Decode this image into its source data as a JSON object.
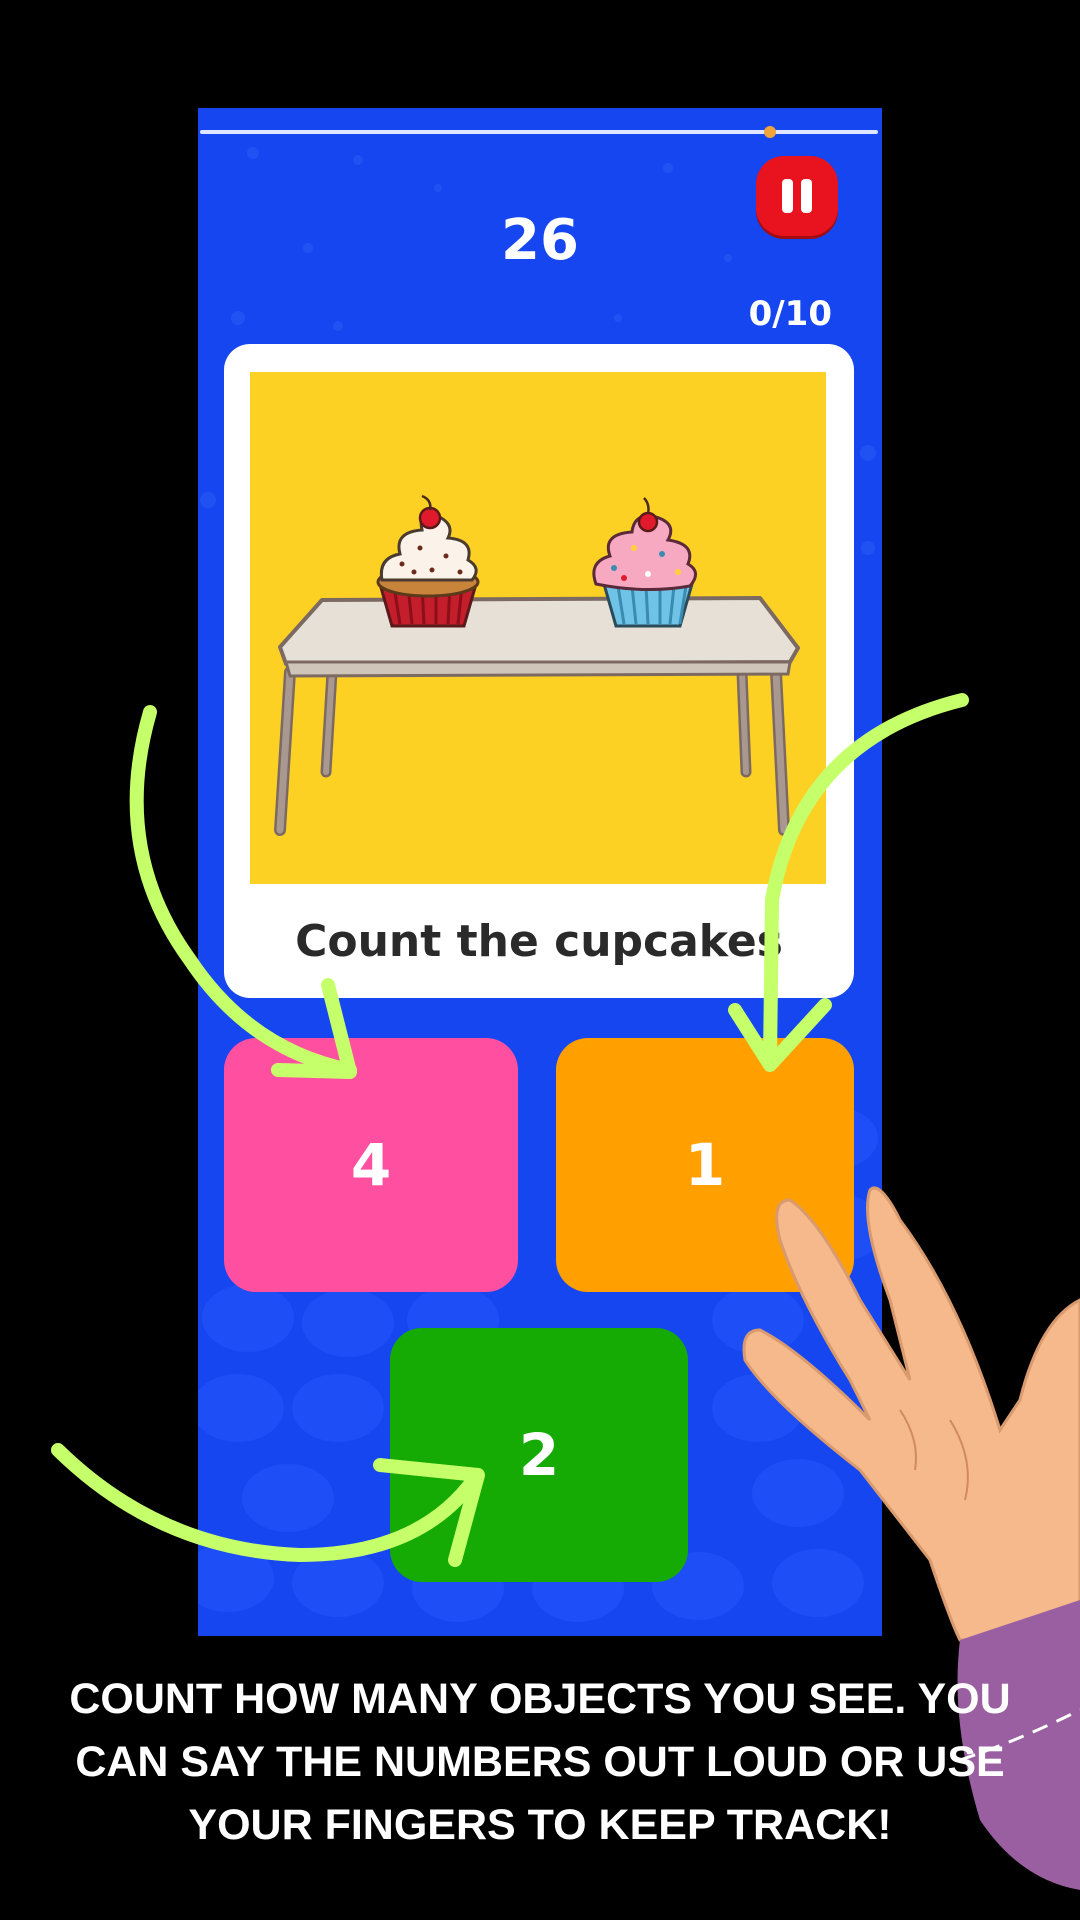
{
  "game": {
    "timer": "26",
    "score": "0/10",
    "progress": 0.84,
    "prompt": "Count the cupcakes",
    "pause_icon": "pause-icon",
    "answers": [
      {
        "label": "4",
        "color": "#ff4fa0"
      },
      {
        "label": "1",
        "color": "#ffa000"
      },
      {
        "label": "2",
        "color": "#16aa05"
      }
    ]
  },
  "caption": "COUNT HOW MANY OBJECTS YOU SEE. YOU CAN SAY THE NUMBERS OUT LOUD OR USE YOUR FINGERS TO KEEP TRACK!",
  "colors": {
    "background": "#000000",
    "screen": "#1546f0",
    "card_image": "#fdd024",
    "pause": "#e8131e",
    "arrow": "#c5ff6a",
    "hand": "#f5b98c",
    "sleeve": "#9a5fa0"
  }
}
